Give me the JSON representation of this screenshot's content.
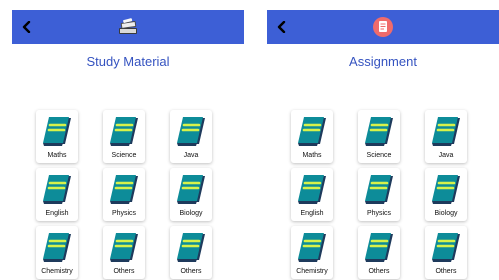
{
  "colors": {
    "header_bg": "#3d5fd6",
    "title_text": "#3553c0",
    "book_teal": "#0d8c99",
    "book_dark": "#1e3a5c",
    "book_stripe": "#d7f24a"
  },
  "left_panel": {
    "header_icon": "books-icon",
    "title": "Study Material",
    "subjects": [
      "Maths",
      "Science",
      "Java",
      "English",
      "Physics",
      "Biology",
      "Chemistry",
      "Others",
      "Others"
    ]
  },
  "right_panel": {
    "header_icon": "document-icon",
    "title": "Assignment",
    "subjects": [
      "Maths",
      "Science",
      "Java",
      "English",
      "Physics",
      "Biology",
      "Chemistry",
      "Others",
      "Others"
    ]
  }
}
